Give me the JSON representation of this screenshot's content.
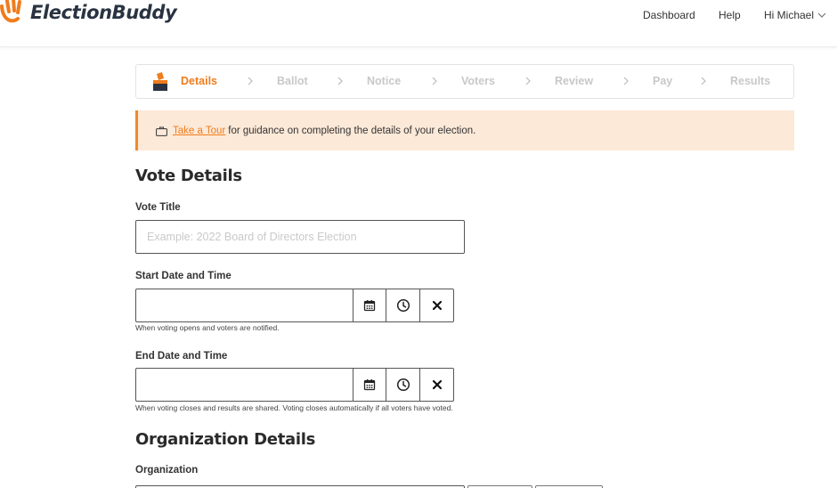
{
  "brand": {
    "name": "ElectionBuddy",
    "accent": "#f07c1c",
    "text_color": "#2a3342"
  },
  "topnav": {
    "dashboard": "Dashboard",
    "help": "Help",
    "user": "Hi Michael",
    "user_icon": "chevron-down-icon"
  },
  "stepper": {
    "steps": [
      "Details",
      "Ballot",
      "Notice",
      "Voters",
      "Review",
      "Pay",
      "Results"
    ],
    "active": "Details",
    "active_icon": "ballot-box-icon",
    "separator_icon": "chevron-right-icon"
  },
  "banner": {
    "icon": "briefcase-icon",
    "link": "Take a Tour",
    "text": "for guidance on completing the details of your election.",
    "background": "#fde9d8",
    "border": "#f08a2a"
  },
  "vote_details": {
    "heading": "Vote Details",
    "title_label": "Vote Title",
    "title_value": "",
    "title_placeholder": "Example: 2022 Board of Directors Election",
    "start_label": "Start Date and Time",
    "start_value": "",
    "start_help": "When voting opens and voters are notified.",
    "end_label": "End Date and Time",
    "end_value": "",
    "end_help": "When voting closes and results are shared. Voting closes automatically if all voters have voted.",
    "picker_icons": [
      "calendar-icon",
      "clock-icon",
      "close-icon"
    ]
  },
  "organization_details": {
    "heading": "Organization Details",
    "org_label": "Organization"
  }
}
